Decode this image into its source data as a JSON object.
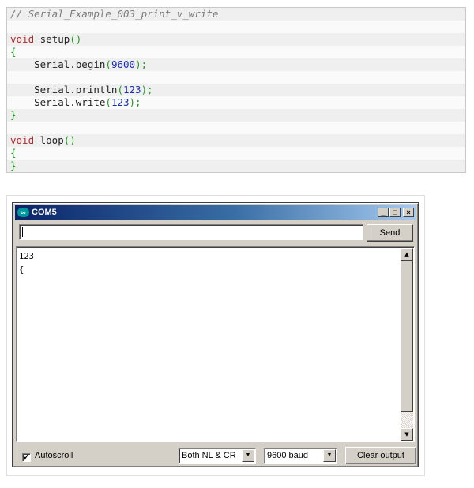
{
  "code": {
    "lines": [
      [
        {
          "t": "// Serial_Example_003_print_v_write",
          "c": "comment"
        }
      ],
      [],
      [
        {
          "t": "void",
          "c": "keyword"
        },
        {
          "t": " setup",
          "c": "fn"
        },
        {
          "t": "()",
          "c": "paren"
        }
      ],
      [
        {
          "t": "{",
          "c": "paren"
        }
      ],
      [
        {
          "t": "    Serial.begin",
          "c": "fn"
        },
        {
          "t": "(",
          "c": "paren"
        },
        {
          "t": "9600",
          "c": "num"
        },
        {
          "t": ");",
          "c": "paren"
        }
      ],
      [],
      [
        {
          "t": "    Serial.println",
          "c": "fn"
        },
        {
          "t": "(",
          "c": "paren"
        },
        {
          "t": "123",
          "c": "num"
        },
        {
          "t": ");",
          "c": "paren"
        }
      ],
      [
        {
          "t": "    Serial.write",
          "c": "fn"
        },
        {
          "t": "(",
          "c": "paren"
        },
        {
          "t": "123",
          "c": "num"
        },
        {
          "t": ");",
          "c": "paren"
        }
      ],
      [
        {
          "t": "}",
          "c": "paren"
        }
      ],
      [],
      [
        {
          "t": "void",
          "c": "keyword"
        },
        {
          "t": " loop",
          "c": "fn"
        },
        {
          "t": "()",
          "c": "paren"
        }
      ],
      [
        {
          "t": "{",
          "c": "paren"
        }
      ],
      [
        {
          "t": "}",
          "c": "paren"
        }
      ]
    ]
  },
  "monitor": {
    "title": "COM5",
    "send_input_value": "",
    "send_label": "Send",
    "output_lines": [
      "123",
      "{"
    ],
    "autoscroll_label": "Autoscroll",
    "autoscroll_checked": true,
    "line_ending_selected": "Both NL & CR",
    "baud_selected": "9600 baud",
    "clear_label": "Clear output"
  }
}
